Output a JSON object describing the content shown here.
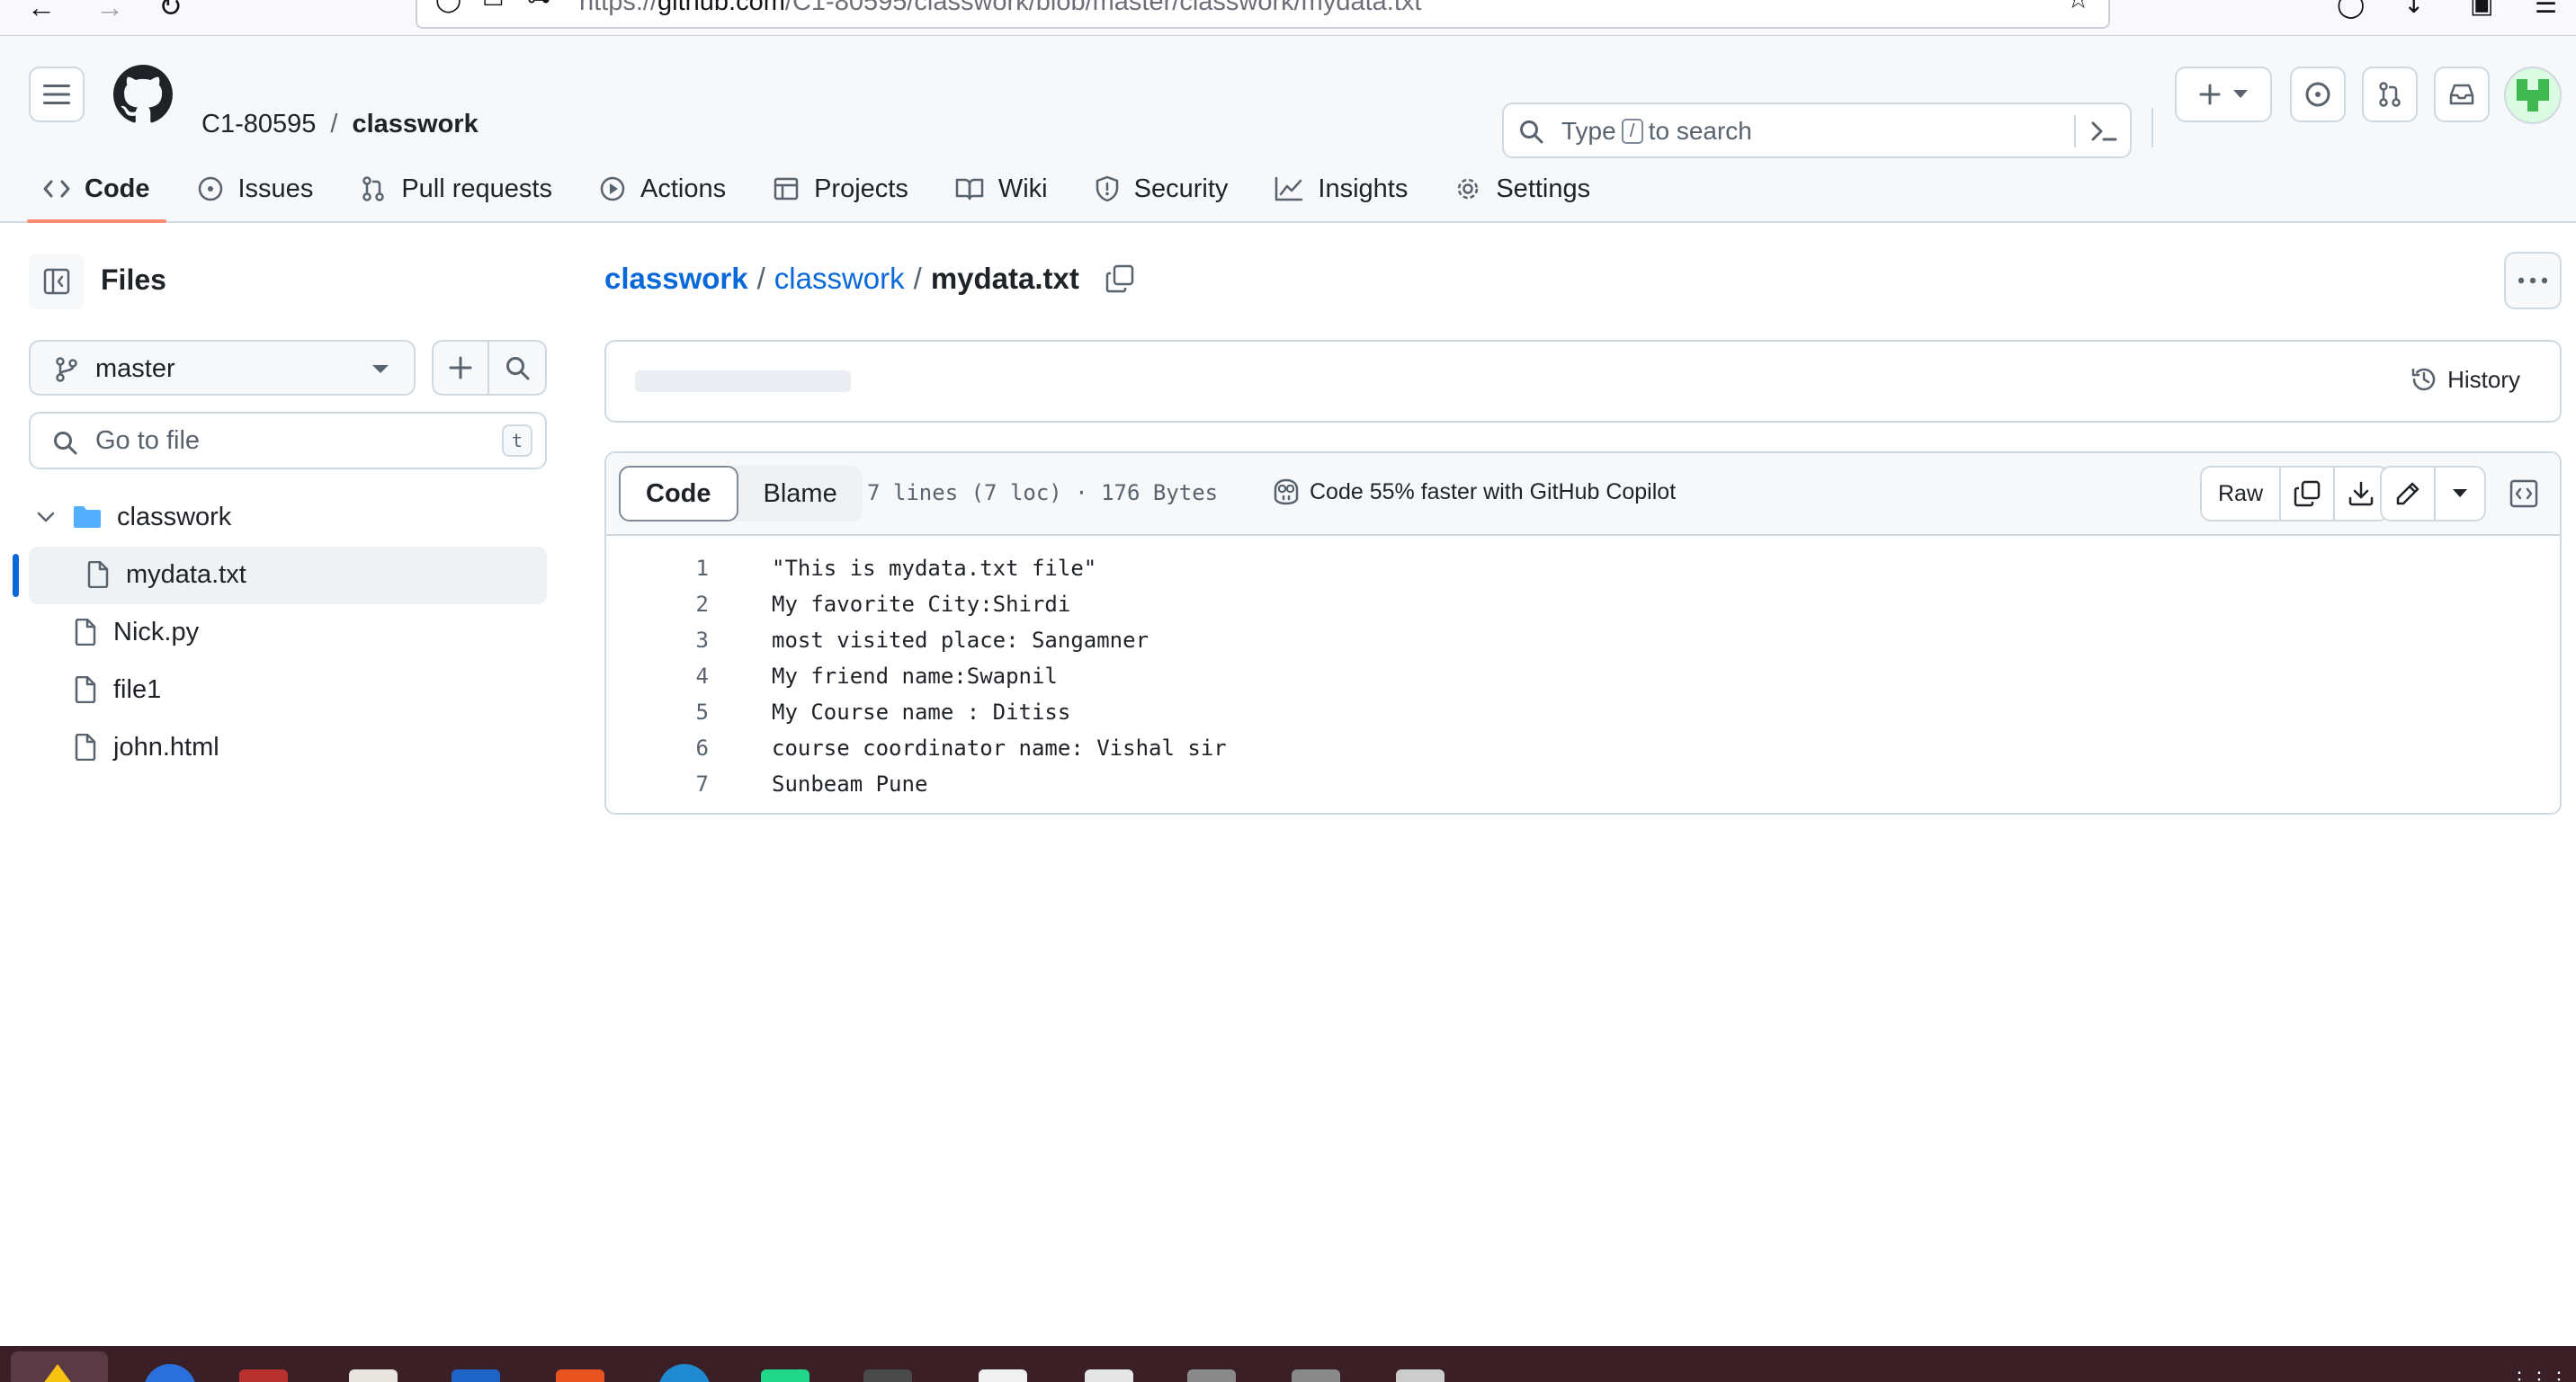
{
  "browser": {
    "url_prefix": "https://",
    "url_domain": "github.com",
    "url_path": "/C1-80595/classwork/blob/master/classwork/mydata.txt"
  },
  "header": {
    "owner": "C1-80595",
    "separator": "/",
    "repo": "classwork",
    "search_placeholder_pre": "Type",
    "search_placeholder_key": "/",
    "search_placeholder_post": "to search"
  },
  "nav_tabs": [
    {
      "label": "Code",
      "icon": "code-icon",
      "active": true
    },
    {
      "label": "Issues",
      "icon": "issue-opened-icon"
    },
    {
      "label": "Pull requests",
      "icon": "git-pull-request-icon"
    },
    {
      "label": "Actions",
      "icon": "play-icon"
    },
    {
      "label": "Projects",
      "icon": "table-icon"
    },
    {
      "label": "Wiki",
      "icon": "book-icon"
    },
    {
      "label": "Security",
      "icon": "shield-icon"
    },
    {
      "label": "Insights",
      "icon": "graph-icon"
    },
    {
      "label": "Settings",
      "icon": "gear-icon"
    }
  ],
  "sidebar": {
    "title": "Files",
    "branch": "master",
    "goto_placeholder": "Go to file",
    "goto_shortcut": "t",
    "tree": [
      {
        "name": "classwork",
        "type": "folder",
        "expanded": true
      },
      {
        "name": "mydata.txt",
        "type": "file",
        "selected": true
      },
      {
        "name": "Nick.py",
        "type": "file"
      },
      {
        "name": "file1",
        "type": "file"
      },
      {
        "name": "john.html",
        "type": "file"
      }
    ]
  },
  "breadcrumb": {
    "repo": "classwork",
    "sep": "/",
    "folder": "classwork",
    "file": "mydata.txt"
  },
  "commit_bar": {
    "history_label": "History"
  },
  "file_view": {
    "tab_code": "Code",
    "tab_blame": "Blame",
    "meta": "7 lines (7 loc) · 176 Bytes",
    "copilot_promo": "Code 55% faster with GitHub Copilot",
    "raw_label": "Raw",
    "lines": [
      {
        "n": "1",
        "text": "\"This is mydata.txt file\""
      },
      {
        "n": "2",
        "text": "My favorite City:Shirdi"
      },
      {
        "n": "3",
        "text": "most visited place: Sangamner"
      },
      {
        "n": "4",
        "text": "My friend name:Swapnil"
      },
      {
        "n": "5",
        "text": "My Course name : Ditiss"
      },
      {
        "n": "6",
        "text": "course coordinator name: Vishal sir"
      },
      {
        "n": "7",
        "text": "Sunbeam Pune"
      }
    ]
  },
  "colors": {
    "accent_link": "#0969da",
    "active_tab_underline": "#fd8c73",
    "folder_icon": "#54aeff",
    "avatar": "#3fb950",
    "taskbar": "#3a1f27"
  }
}
